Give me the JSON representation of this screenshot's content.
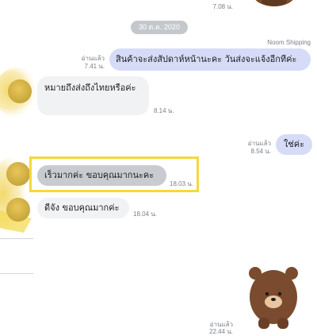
{
  "top": {
    "time": "7.08 น."
  },
  "date_divider": "30 ต.ค. 2020",
  "messages": [
    {
      "sender": "Noom Shipping",
      "text": "สินค้าจะส่งสัปดาห์หน้านะคะ วันส่งจะแจ้งอีกทีค่ะ",
      "read": "อ่านแล้ว",
      "time": "7.41 น."
    },
    {
      "text": "หมายถึงส่งถึงไทยหรือค่ะ",
      "time": "8.14 น."
    },
    {
      "text": "ใช่ค่ะ",
      "read": "อ่านแล้ว",
      "time": "8.54 น."
    },
    {
      "text": "เร็วมากค่ะ ขอบคุณมากนะคะ",
      "time": "18.03 น."
    },
    {
      "text": "ดีจัง ขอบคุณมากค่ะ",
      "time": "18.04 น."
    },
    {
      "read": "อ่านแล้ว",
      "time": "22.44 น."
    }
  ],
  "colors": {
    "outgoing_bubble": "#d6dcf7",
    "incoming_bubble": "#f1f2f4",
    "highlight_border": "#f5d83a",
    "bear_brown": "#7a4b2e"
  },
  "icons": [
    "bear-sticker",
    "user-avatar"
  ]
}
